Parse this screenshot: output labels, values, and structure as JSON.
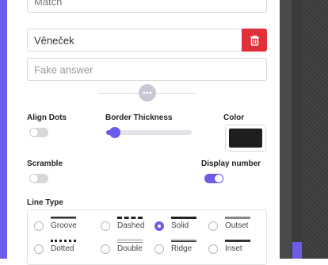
{
  "top_field": {
    "value": "Match"
  },
  "answer_field": {
    "value": "Věneček"
  },
  "fake_field": {
    "placeholder": "Fake answer"
  },
  "settings": {
    "align_dots": {
      "label": "Align Dots",
      "on": false
    },
    "border_thickness": {
      "label": "Border Thickness",
      "level": 0.05
    },
    "color": {
      "label": "Color",
      "value": "#1e1e1e"
    },
    "scramble": {
      "label": "Scramble",
      "on": false
    },
    "display_number": {
      "label": "Display number",
      "on": true
    }
  },
  "line_type": {
    "label": "Line Type",
    "options": [
      {
        "label": "Groove",
        "style": "groove",
        "selected": false
      },
      {
        "label": "Dashed",
        "style": "dashed",
        "selected": false
      },
      {
        "label": "Solid",
        "style": "solid",
        "selected": true
      },
      {
        "label": "Outset",
        "style": "outset",
        "selected": false
      },
      {
        "label": "Dotted",
        "style": "dotted",
        "selected": false
      },
      {
        "label": "Double",
        "style": "double",
        "selected": false
      },
      {
        "label": "Ridge",
        "style": "ridge",
        "selected": false
      },
      {
        "label": "Inset",
        "style": "inset",
        "selected": false
      }
    ]
  },
  "colors": {
    "accent": "#6c5ce7",
    "danger": "#e0313b"
  },
  "icons": {
    "delete": "trash-icon",
    "more": "more-dots-icon"
  }
}
